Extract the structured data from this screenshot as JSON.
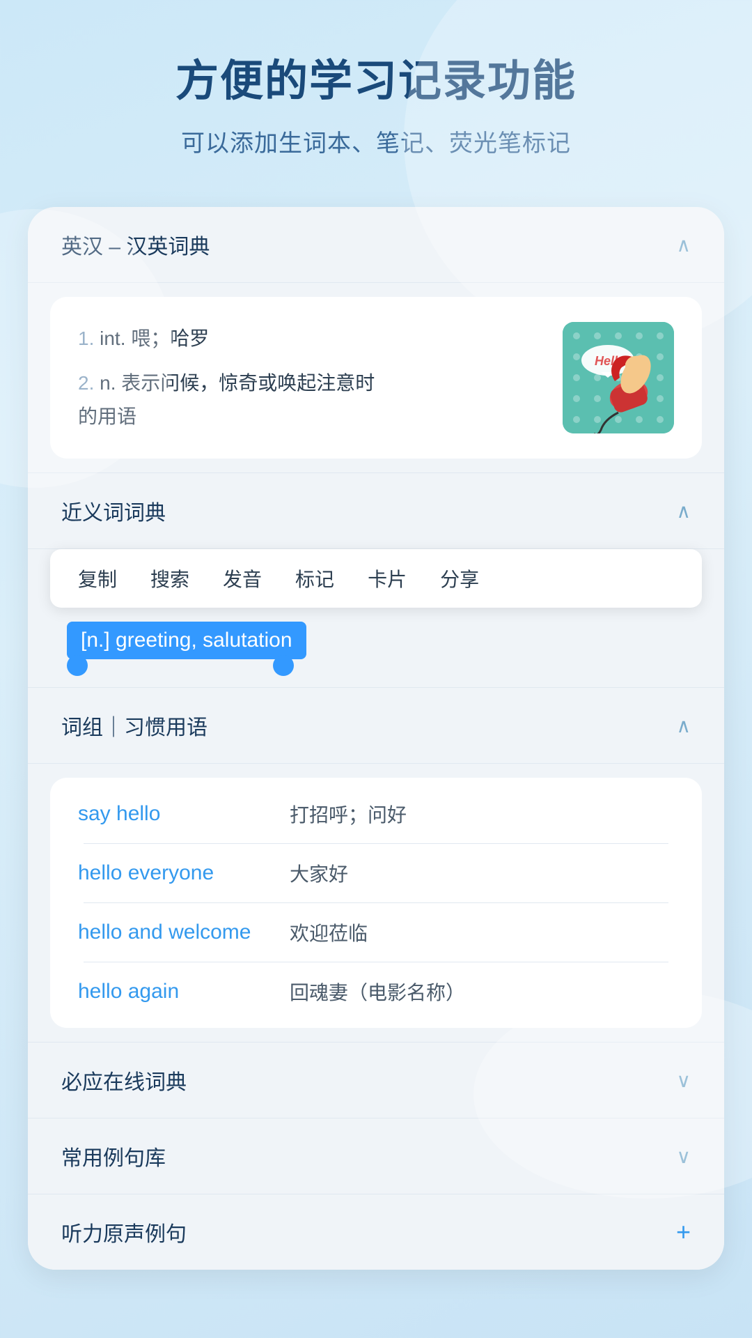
{
  "header": {
    "title": "方便的学习记录功能",
    "subtitle": "可以添加生词本、笔记、荧光笔标记"
  },
  "dict_section": {
    "title": "英汉 – 汉英词典",
    "definitions": [
      {
        "number": "1.",
        "text": "int. 喂；哈罗"
      },
      {
        "number": "2.",
        "text": "n. 表示问候，惊奇或唤起注意时的用语"
      }
    ]
  },
  "context_menu": {
    "items": [
      "复制",
      "搜索",
      "发音",
      "标记",
      "卡片",
      "分享"
    ]
  },
  "synonym_section": {
    "title": "近义词词典",
    "highlighted_text": "[n.] greeting, salutation"
  },
  "phrases_section": {
    "title": "词组｜习惯用语",
    "items": [
      {
        "en": "say hello",
        "cn": "打招呼；问好"
      },
      {
        "en": "hello everyone",
        "cn": "大家好"
      },
      {
        "en": "hello and welcome",
        "cn": "欢迎莅临"
      },
      {
        "en": "hello again",
        "cn": "回魂妻（电影名称）"
      }
    ]
  },
  "bottom_sections": [
    {
      "title": "必应在线词典",
      "icon": "chevron-down",
      "show_plus": false
    },
    {
      "title": "常用例句库",
      "icon": "chevron-down",
      "show_plus": false
    },
    {
      "title": "听力原声例句",
      "icon": "plus",
      "show_plus": true
    }
  ],
  "icons": {
    "chevron_up": "∧",
    "chevron_down": "∨",
    "plus": "+"
  }
}
